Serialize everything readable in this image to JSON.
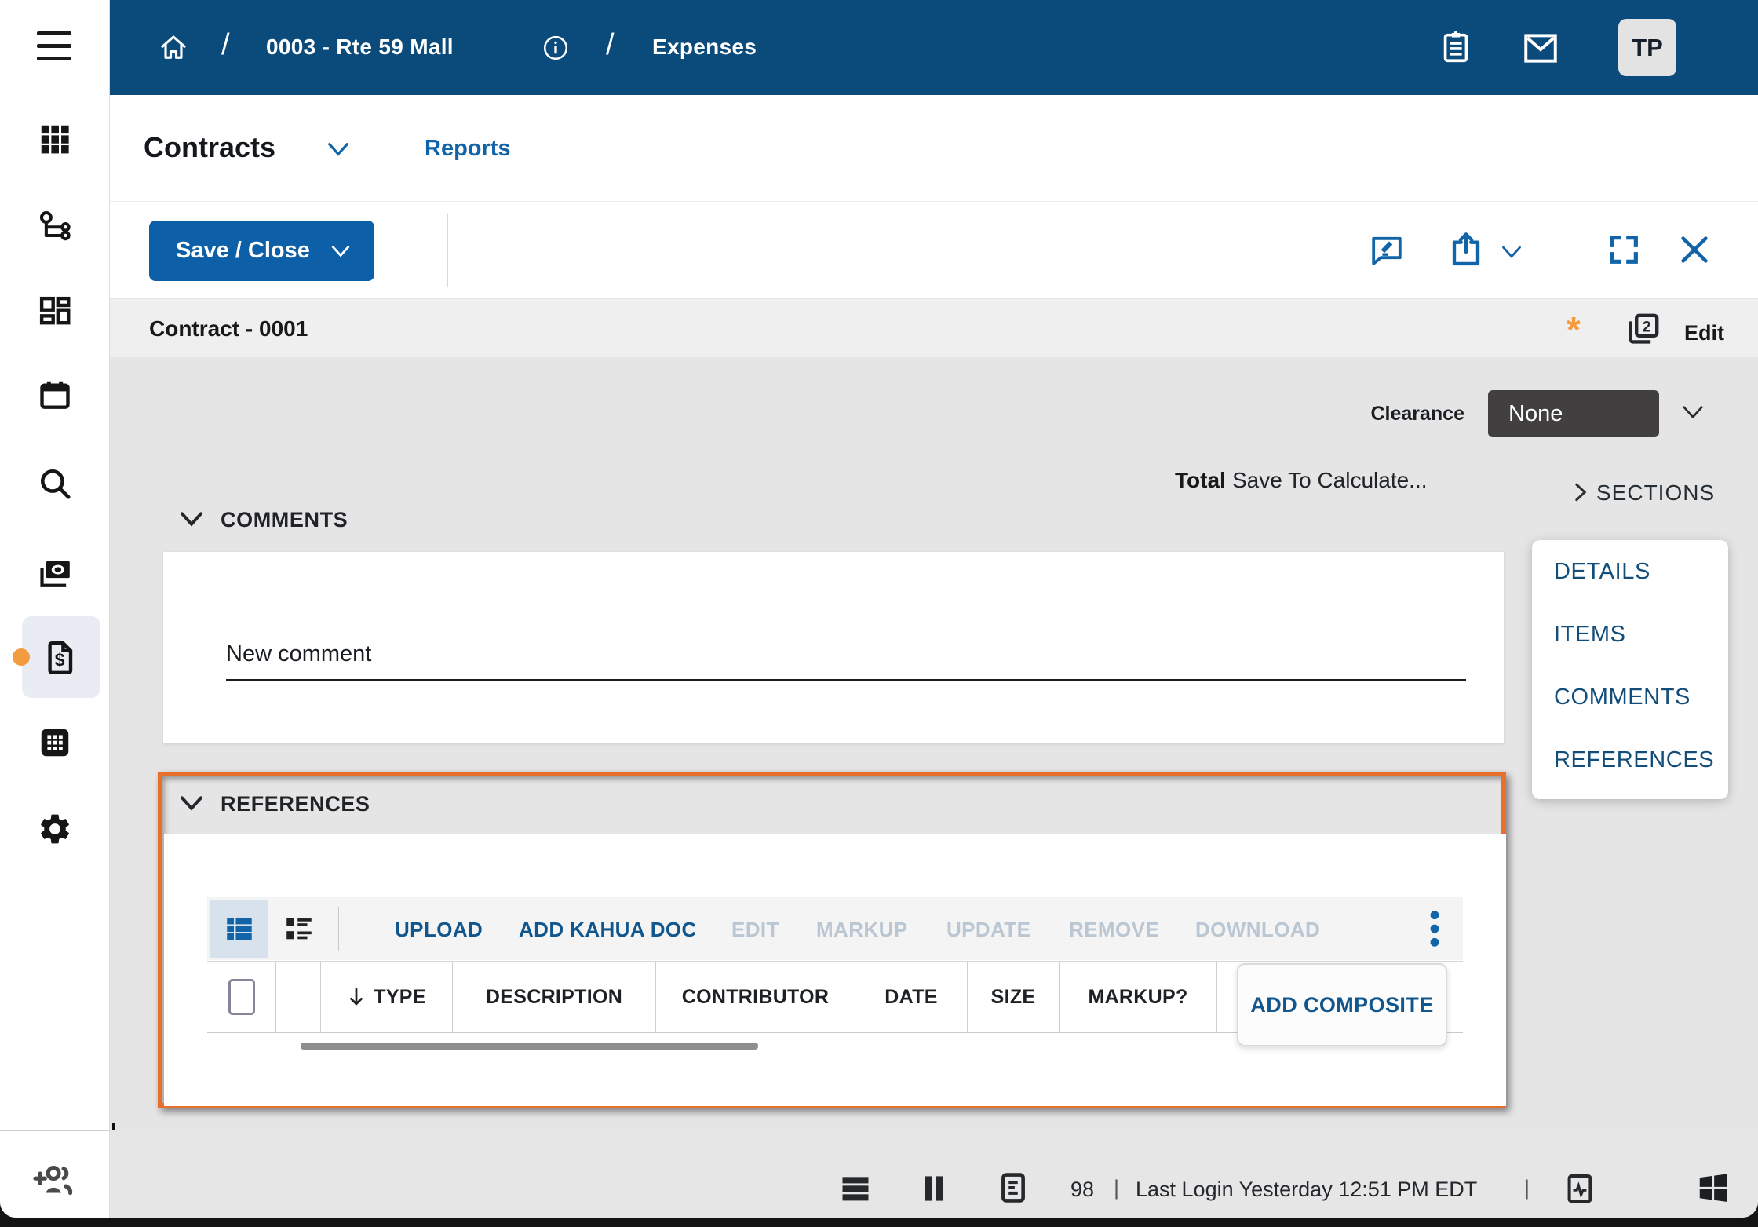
{
  "topbar": {
    "breadcrumb": {
      "separator": "/",
      "project": "0003 - Rte 59 Mall",
      "app": "Expenses"
    },
    "avatar": "TP"
  },
  "app_header": {
    "title": "Contracts",
    "reports_link": "Reports"
  },
  "action_bar": {
    "save_button": "Save / Close"
  },
  "record_bar": {
    "title": "Contract - 0001",
    "dirty_indicator": "*",
    "edit_label": "Edit"
  },
  "detail": {
    "clearance_label": "Clearance",
    "clearance_value": "None",
    "total_label": "Total",
    "total_value": "Save To Calculate...",
    "sections_toggle": "SECTIONS"
  },
  "sections_panel": {
    "items": [
      "DETAILS",
      "ITEMS",
      "COMMENTS",
      "REFERENCES"
    ]
  },
  "comments": {
    "header": "COMMENTS",
    "new_comment_value": "New comment"
  },
  "references": {
    "header": "REFERENCES",
    "toolbar": {
      "buttons": [
        {
          "label": "UPLOAD",
          "enabled": true
        },
        {
          "label": "ADD KAHUA DOC",
          "enabled": true
        },
        {
          "label": "EDIT",
          "enabled": false
        },
        {
          "label": "MARKUP",
          "enabled": false
        },
        {
          "label": "UPDATE",
          "enabled": false
        },
        {
          "label": "REMOVE",
          "enabled": false
        },
        {
          "label": "DOWNLOAD",
          "enabled": false
        }
      ]
    },
    "table": {
      "columns": [
        "TYPE",
        "DESCRIPTION",
        "CONTRIBUTOR",
        "DATE",
        "SIZE",
        "MARKUP?"
      ]
    },
    "menu": {
      "add_composite": "ADD COMPOSITE"
    }
  },
  "status_bar": {
    "count": "98",
    "separator": "|",
    "last_login": "Last Login Yesterday 12:51 PM EDT"
  },
  "colors": {
    "brand_blue": "#0b4b7c",
    "accent_blue": "#1264a8",
    "section_link_blue": "#134e7b",
    "save_button_blue": "#0d5fa7",
    "orange_frame": "#e8702a",
    "orange_marker": "#f29b3f",
    "dark_select": "#413f40",
    "disabled_text": "#bac7d3",
    "content_gray": "#e6e5e6"
  }
}
